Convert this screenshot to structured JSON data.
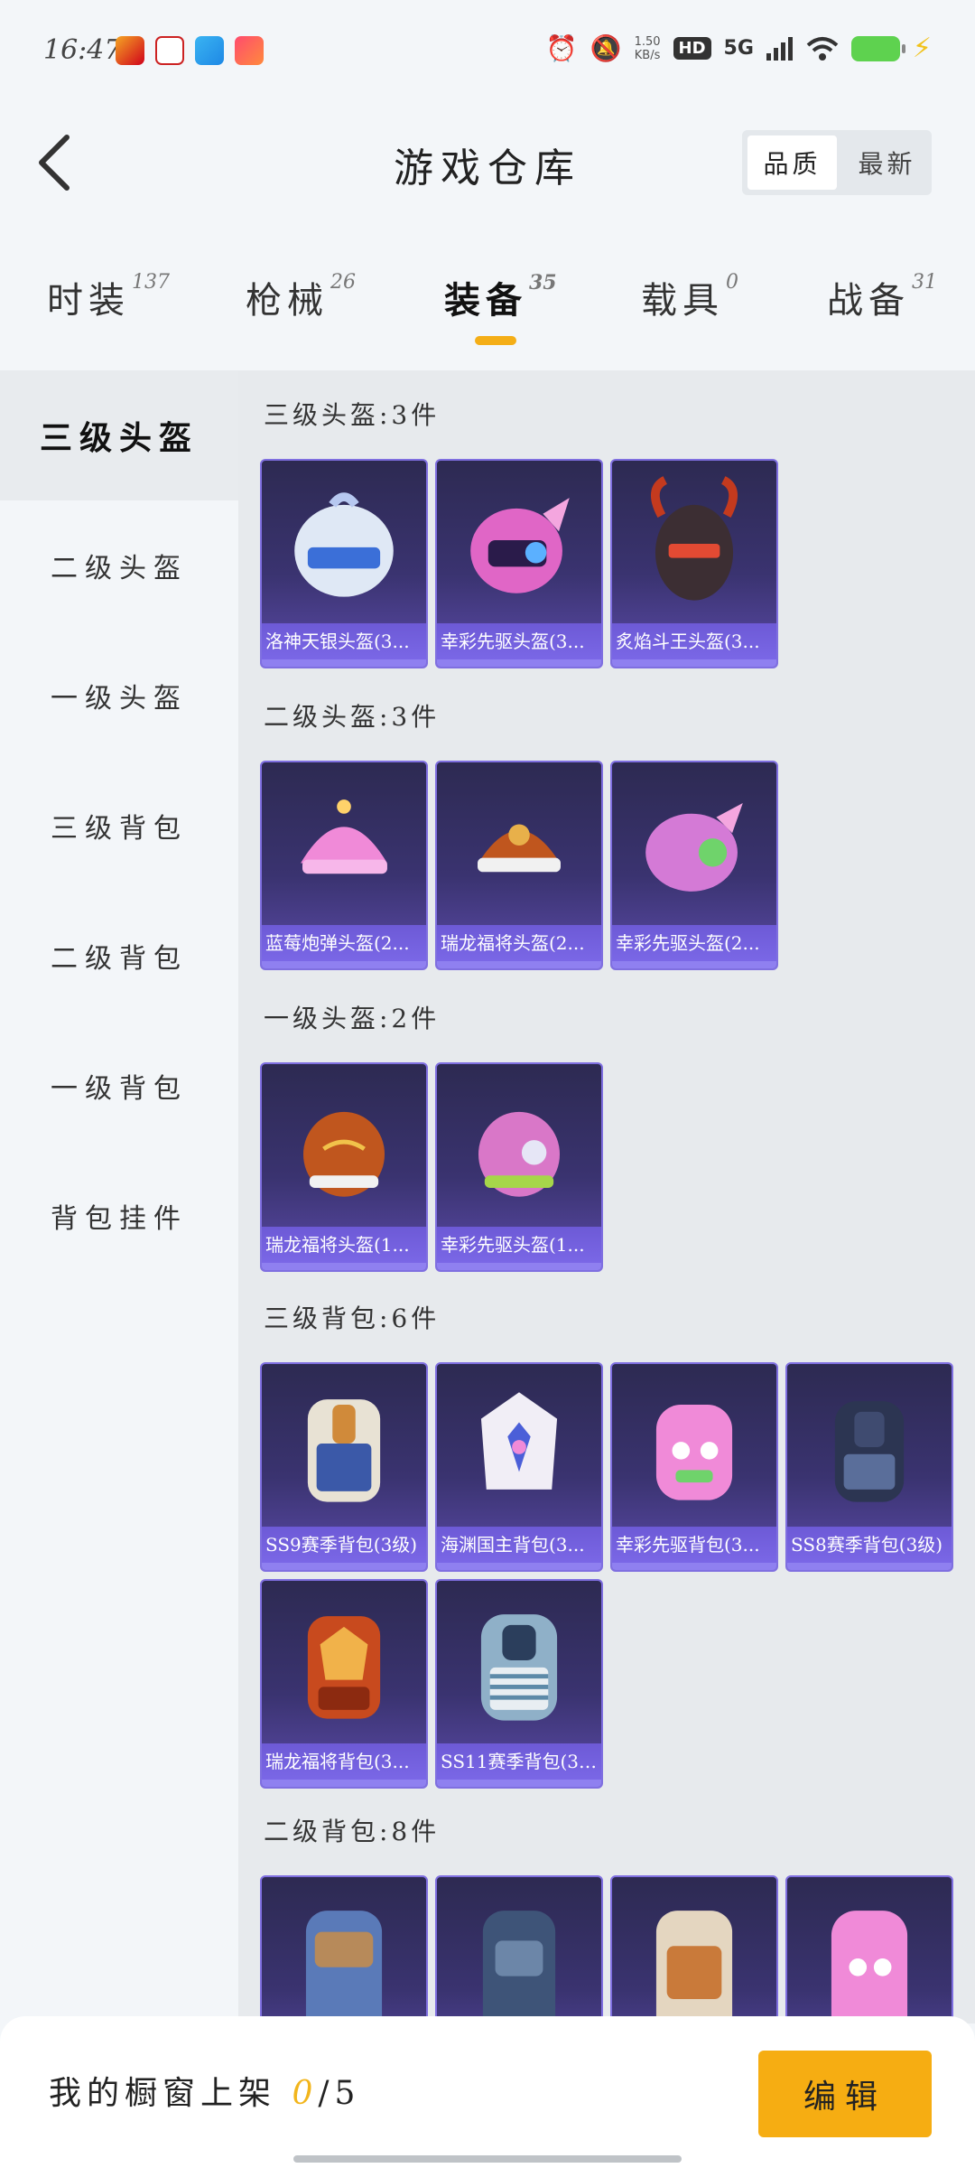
{
  "status_bar": {
    "time": "16:47",
    "net_speed_value": "1.50",
    "net_speed_unit": "KB/s",
    "hd_label": "HD",
    "network_label": "5G",
    "app_icons": [
      "game-app-icon",
      "mask-app-icon",
      "telegram-icon",
      "video-app-icon"
    ],
    "icons": [
      "alarm-icon",
      "mute-icon",
      "signal-icon",
      "wifi-icon",
      "battery-icon",
      "charging-icon"
    ]
  },
  "header": {
    "title": "游戏仓库",
    "sort_options": [
      "品质",
      "最新"
    ],
    "active_sort": "品质"
  },
  "tabs": [
    {
      "label": "时装",
      "count": "137"
    },
    {
      "label": "枪械",
      "count": "26"
    },
    {
      "label": "装备",
      "count": "35"
    },
    {
      "label": "载具",
      "count": "0"
    },
    {
      "label": "战备",
      "count": "31"
    }
  ],
  "active_tab": "装备",
  "sidebar": {
    "items": [
      "三级头盔",
      "二级头盔",
      "一级头盔",
      "三级背包",
      "二级背包",
      "一级背包",
      "背包挂件"
    ],
    "active": "三级头盔"
  },
  "sections": [
    {
      "title": "三级头盔:3件",
      "items": [
        "洛神天银头盔(3...",
        "幸彩先驱头盔(3...",
        "炙焰斗王头盔(3..."
      ]
    },
    {
      "title": "二级头盔:3件",
      "items": [
        "蓝莓炮弹头盔(2...",
        "瑞龙福将头盔(2...",
        "幸彩先驱头盔(2..."
      ]
    },
    {
      "title": "一级头盔:2件",
      "items": [
        "瑞龙福将头盔(1...",
        "幸彩先驱头盔(1..."
      ]
    },
    {
      "title": "三级背包:6件",
      "items": [
        "SS9赛季背包(3级)",
        "海渊国主背包(3...",
        "幸彩先驱背包(3...",
        "SS8赛季背包(3级)",
        "瑞龙福将背包(3...",
        "SS11赛季背包(3级)"
      ]
    },
    {
      "title": "二级背包:8件",
      "items": [
        "",
        "",
        "",
        ""
      ]
    }
  ],
  "bottom": {
    "shop_label": "我的橱窗上架",
    "shop_current": "0",
    "shop_total": "/5",
    "edit_label": "编辑"
  },
  "colors": {
    "accent": "#f6ad12",
    "card_top": "#2d2a52",
    "card_bottom": "#5b4aa8",
    "card_border": "#7f6fe0"
  }
}
